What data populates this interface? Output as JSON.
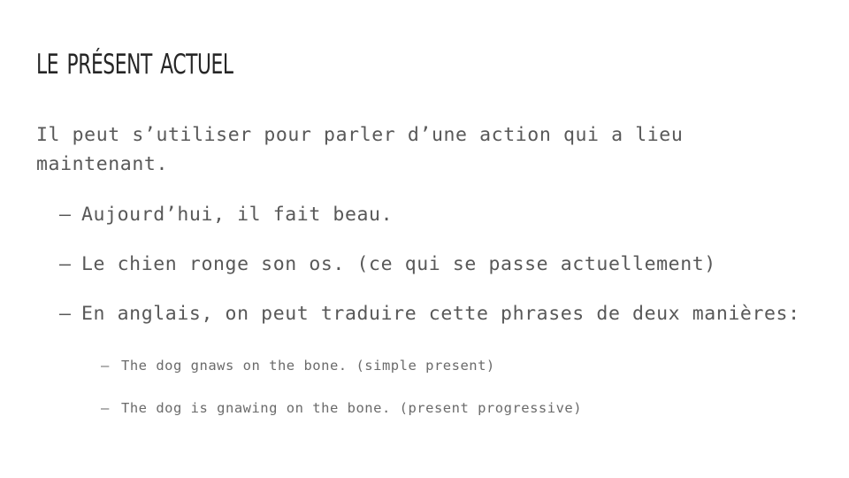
{
  "slide": {
    "title": "Le présent actuel",
    "lead": "Il peut s’utiliser pour parler d’une action qui a lieu maintenant.",
    "bullet_marker": "–",
    "bullets": [
      {
        "text": "Aujourd’hui, il fait beau."
      },
      {
        "text": "Le chien ronge son os. (ce qui se passe actuellement)"
      },
      {
        "text": "En anglais, on peut traduire cette phrases de deux manières:"
      }
    ],
    "sub_bullets": [
      {
        "text": "The dog gnaws on the bone. (simple present)"
      },
      {
        "text": "The dog is gnawing on the bone. (present progressive)"
      }
    ],
    "colors": {
      "background": "#ffffff",
      "title": "#262626",
      "body": "#585858",
      "sub_body": "#6b6b6b"
    }
  }
}
